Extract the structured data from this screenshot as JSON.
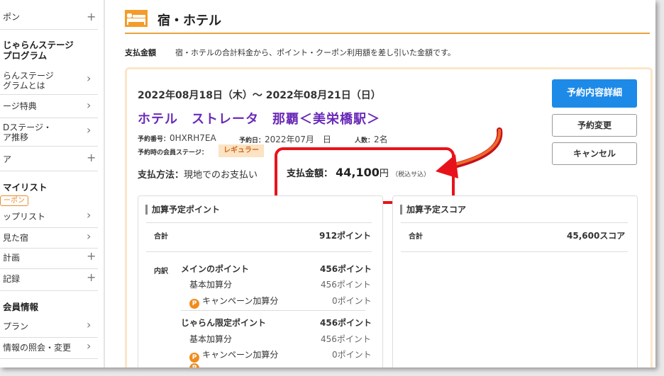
{
  "sidebar": {
    "items": [
      {
        "label": "ポン",
        "control": "+"
      },
      {
        "label": "ンステージ",
        "control": ">"
      },
      {
        "label": "ージ特典",
        "control": ">"
      },
      {
        "label": "Dステージ・\nア推移",
        "control": ">"
      },
      {
        "label": "ア",
        "control": "+"
      },
      {
        "label": "ップリスト",
        "control": ">"
      },
      {
        "label": "見た宿",
        "control": ">"
      },
      {
        "label": "計画",
        "control": "+"
      },
      {
        "label": "記録",
        "control": "+"
      },
      {
        "label": "プラン",
        "control": ">"
      },
      {
        "label": "情報の照会・変更",
        "control": ">"
      }
    ],
    "stage_heading": "じゃらんステージ\nプログラム",
    "stage_about": "らんステージ\nグラムとは",
    "mylist_heading": "マイリスト",
    "coupon_tag": "ーポン",
    "member_heading": "会員情報"
  },
  "header": {
    "title": "宿・ホテル",
    "pay_label": "支払金額",
    "pay_desc": "宿・ホテルの合計料金から、ポイント・クーポン利用額を差し引いた金額です。"
  },
  "reservation": {
    "dates": "2022年08月18日（木）～ 2022年08月21日（日）",
    "hotel_name": "ホテル　ストレータ　那覇＜美栄橋駅＞",
    "number_label": "予約番号：",
    "number": "0HXRH7EA",
    "date_label": "予約日：",
    "date": "2022年07月　日",
    "people_label": "人数：",
    "people": "2名",
    "stage_label": "予約時の会員ステージ：",
    "stage": "レギュラー",
    "method_label": "支払方法：",
    "method": "現地でのお支払い",
    "total_label": "支払金額：",
    "total_amount": "44,100",
    "total_unit": "円",
    "tax_note": "（税込サ込）"
  },
  "buttons": {
    "detail": "予約内容詳細",
    "change": "予約変更",
    "cancel": "キャンセル"
  },
  "points_panel": {
    "title": "加算予定ポイント",
    "total_label": "合計",
    "total_value": "912ポイント",
    "breakdown_label": "内訳",
    "main_label": "メインのポイント",
    "main_value": "456ポイント",
    "main_base_label": "基本加算分",
    "main_base_value": "456ポイント",
    "main_campaign_label": "キャンペーン加算分",
    "main_campaign_value": "0ポイント",
    "jalan_label": "じゃらん限定ポイント",
    "jalan_value": "456ポイント",
    "jalan_base_label": "基本加算分",
    "jalan_base_value": "456ポイント",
    "jalan_campaign_label": "キャンペーン加算分",
    "jalan_campaign_value": "0ポイント"
  },
  "score_panel": {
    "title": "加算予定スコア",
    "total_label": "合計",
    "total_value": "45,600スコア"
  },
  "colors": {
    "accent_orange": "#e8a33c",
    "hotel_purple": "#6a2ab8",
    "primary_blue": "#1d8ae8",
    "highlight_red": "#e8131a"
  }
}
